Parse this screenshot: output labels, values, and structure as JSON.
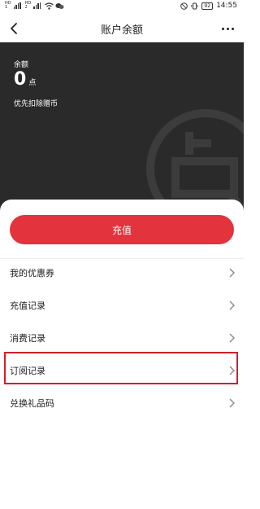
{
  "status_bar": {
    "time": "14:55",
    "battery": "92"
  },
  "nav": {
    "title": "账户余额"
  },
  "balance": {
    "label": "余额",
    "amount": "0",
    "unit": "点",
    "note": "优先扣除赠币"
  },
  "actions": {
    "recharge_label": "充值"
  },
  "menu": {
    "items": [
      {
        "label": "我的优惠券"
      },
      {
        "label": "充值记录"
      },
      {
        "label": "消费记录"
      },
      {
        "label": "订阅记录"
      },
      {
        "label": "兑换礼品码"
      }
    ]
  },
  "colors": {
    "accent": "#e3333d",
    "panel": "#2a2a2a",
    "highlight": "#d0202a"
  }
}
